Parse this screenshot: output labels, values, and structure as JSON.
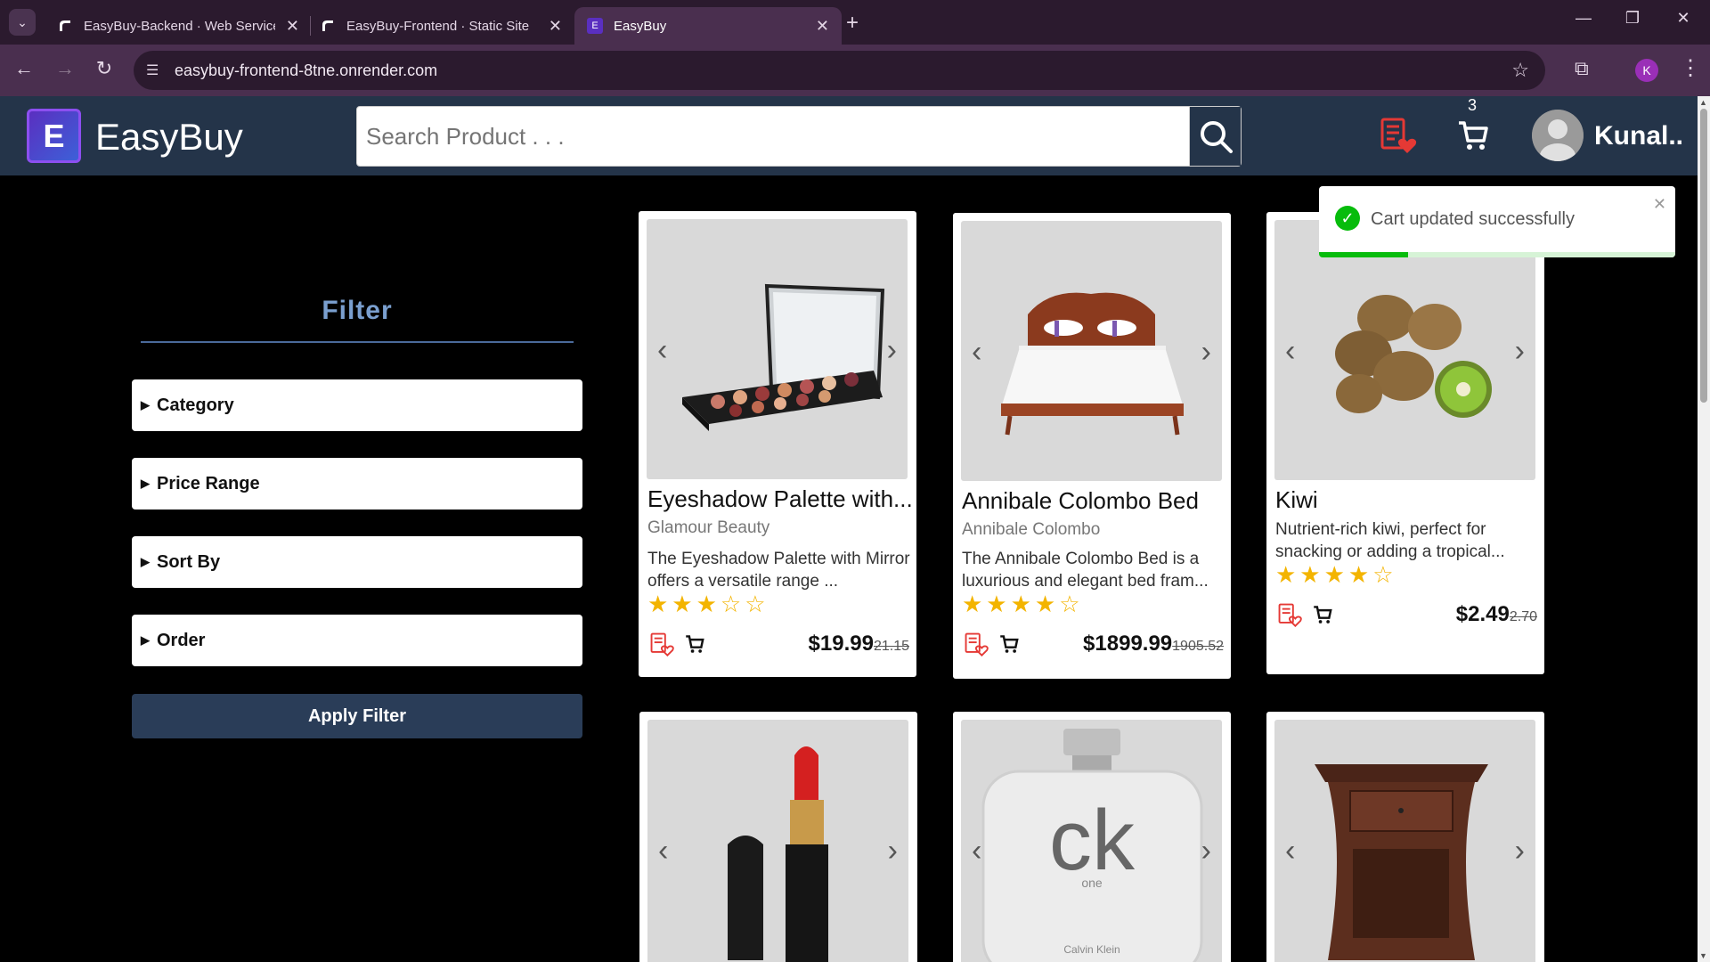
{
  "browser": {
    "tabs": [
      {
        "title": "EasyBuy-Backend · Web Service"
      },
      {
        "title": "EasyBuy-Frontend · Static Site"
      },
      {
        "title": "EasyBuy"
      }
    ],
    "url": "easybuy-frontend-8tne.onrender.com",
    "profile_initial": "K"
  },
  "header": {
    "logo_letter": "E",
    "brand": "EasyBuy",
    "search_placeholder": "Search Product . . .",
    "cart_count": "3",
    "user_name": "Kunal.."
  },
  "filter": {
    "title": "Filter",
    "sections": [
      "Category",
      "Price Range",
      "Sort By",
      "Order"
    ],
    "apply_label": "Apply Filter"
  },
  "products": [
    {
      "name": "Eyeshadow Palette with...",
      "brand": "Glamour Beauty",
      "description": "The Eyeshadow Palette with Mirror offers a versatile range ...",
      "rating": 3,
      "price": "$19.99",
      "old_price": "21.15"
    },
    {
      "name": "Annibale Colombo Bed",
      "brand": "Annibale Colombo",
      "description": "The Annibale Colombo Bed is a luxurious and elegant bed fram...",
      "rating": 4,
      "price": "$1899.99",
      "old_price": "1905.52"
    },
    {
      "name": "Kiwi",
      "brand": "",
      "description": "Nutrient-rich kiwi, perfect for snacking or adding a tropical...",
      "rating": 4,
      "price": "$2.49",
      "old_price": "2.70"
    }
  ],
  "lower_products": [
    {
      "image": "lipstick"
    },
    {
      "image": "perfume",
      "image_text": "ck",
      "image_subtext": "one",
      "image_brand": "Calvin Klein"
    },
    {
      "image": "nightstand"
    }
  ],
  "toast": {
    "message": "Cart updated successfully",
    "progress": 0.25,
    "color": "#07bc0c"
  },
  "colors": {
    "header_bg": "#243449",
    "accent_stars": "#f3b400",
    "wishlist_red": "#e53935"
  }
}
